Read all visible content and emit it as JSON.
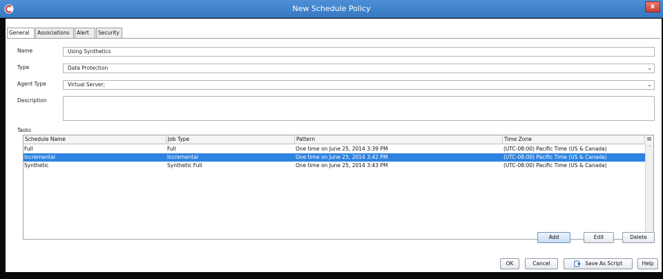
{
  "window": {
    "title": "New Schedule Policy",
    "close_label": "x"
  },
  "tabs": [
    {
      "label": "General",
      "active": true
    },
    {
      "label": "Associations",
      "active": false
    },
    {
      "label": "Alert",
      "active": false
    },
    {
      "label": "Security",
      "active": false
    }
  ],
  "form": {
    "name_label": "Name",
    "name_value": "Using Synthetics",
    "type_label": "Type",
    "type_value": "Data Protection",
    "agent_type_label": "Agent Type",
    "agent_type_value": "Virtual Server;",
    "description_label": "Description",
    "description_value": ""
  },
  "tasks": {
    "label": "Tasks",
    "columns": [
      "Schedule Name",
      "Job Type",
      "Pattern",
      "Time Zone"
    ],
    "rows": [
      {
        "schedule_name": "Full",
        "job_type": "Full",
        "pattern": "One time on June 25, 2014 3:39 PM",
        "time_zone": "(UTC-08:00) Pacific Time (US & Canada)",
        "selected": false
      },
      {
        "schedule_name": "Incremental",
        "job_type": "Incremental",
        "pattern": "One time on June 25, 2014 3:42 PM",
        "time_zone": "(UTC-08:00) Pacific Time (US & Canada)",
        "selected": true
      },
      {
        "schedule_name": "Synthetic",
        "job_type": "Synthetic Full",
        "pattern": "One time on June 25, 2014 3:43 PM",
        "time_zone": "(UTC-08:00) Pacific Time (US & Canada)",
        "selected": false
      }
    ]
  },
  "task_buttons": {
    "add": "Add",
    "edit": "Edit",
    "delete": "Delete"
  },
  "dialog_buttons": {
    "ok": "OK",
    "cancel": "Cancel",
    "save_as_script": "Save As Script",
    "help": "Help"
  },
  "colors": {
    "title_bar": "#3778c2",
    "selection": "#2e83e0",
    "close_button": "#c6403a"
  },
  "icons": {
    "app": "commvault-logo-icon",
    "dropdown": "chevron-down-icon",
    "script": "script-icon",
    "column_chooser": "column-chooser-icon"
  }
}
